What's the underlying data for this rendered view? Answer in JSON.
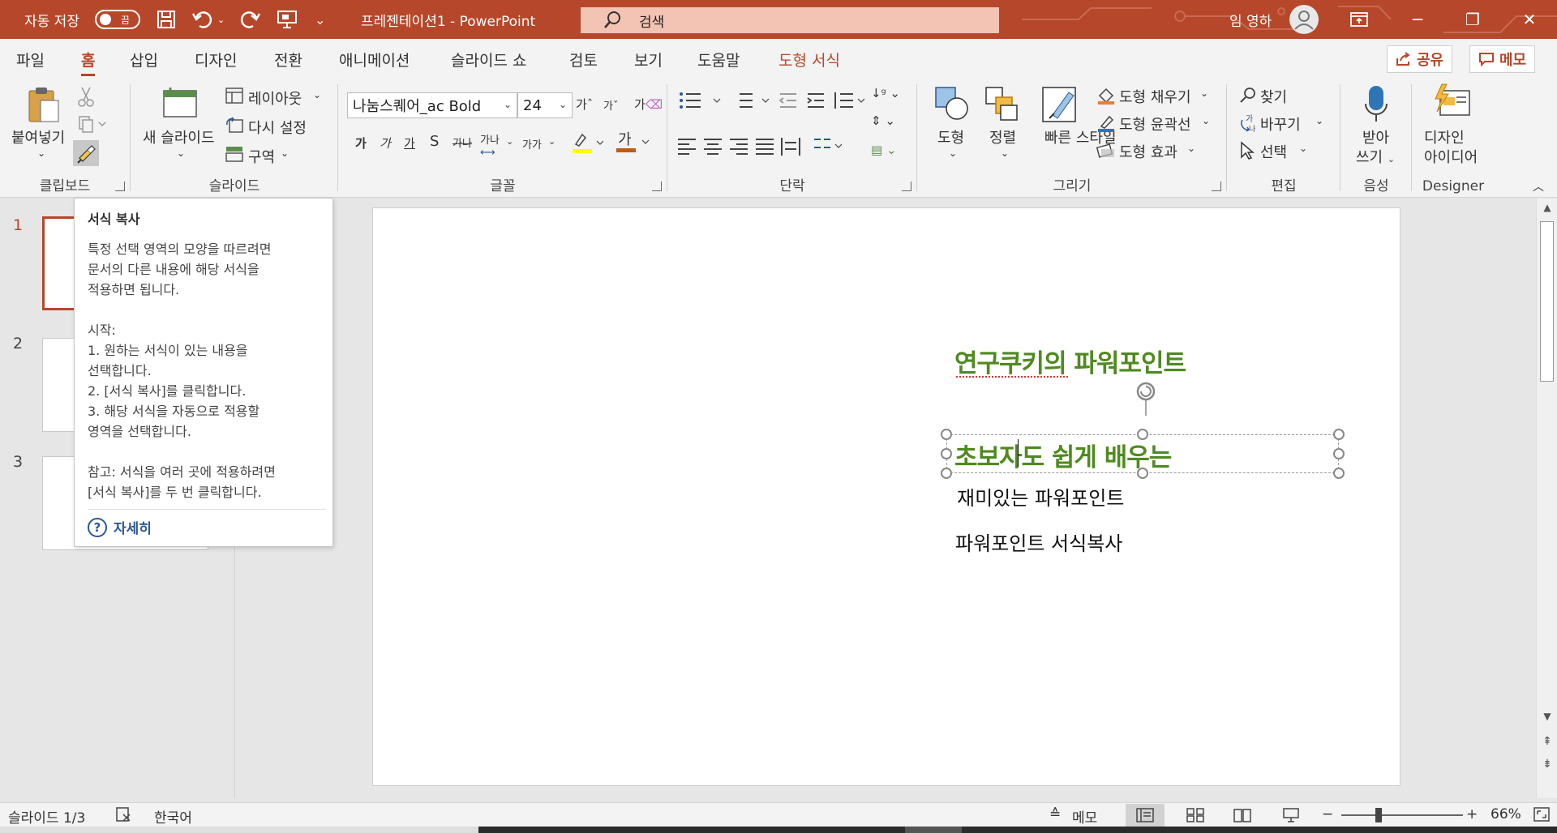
{
  "titlebar": {
    "autosave_label": "자동 저장",
    "autosave_state": "끔",
    "doc_title": "프레젠테이션1 - PowerPoint",
    "search_placeholder": "검색",
    "user_name": "임 영하",
    "accent_color": "#b7472a"
  },
  "tabs": [
    "파일",
    "홈",
    "삽입",
    "디자인",
    "전환",
    "애니메이션",
    "슬라이드 쇼",
    "검토",
    "보기",
    "도움말",
    "도형 서식"
  ],
  "active_tab": "홈",
  "top_buttons": {
    "share": "공유",
    "comments": "메모"
  },
  "ribbon": {
    "clipboard": {
      "paste": "붙여넣기",
      "label": "클립보드"
    },
    "slides": {
      "new_slide": "새 슬라이드",
      "layout": "레이아웃",
      "reset": "다시 설정",
      "section": "구역",
      "label": "슬라이드"
    },
    "font": {
      "font_name": "나눔스퀘어_ac Bold",
      "font_size": "24",
      "bold": "가",
      "italic": "가",
      "underline": "가",
      "shadow": "S",
      "strike": "가나",
      "case": "가가",
      "label": "글꼴"
    },
    "paragraph": {
      "label": "단락"
    },
    "drawing": {
      "shape": "도형",
      "arrange": "정렬",
      "quick_styles": "빠른 스타일",
      "fill": "도형 채우기",
      "outline": "도형 윤곽선",
      "effects": "도형 효과",
      "label": "그리기"
    },
    "editing": {
      "find": "찾기",
      "replace": "바꾸기",
      "select": "선택",
      "label": "편집"
    },
    "voice": {
      "dictate": "받아 쓰기",
      "label": "음성"
    },
    "designer": {
      "ideas": "디자인 아이디어",
      "label": "Designer"
    }
  },
  "slide_numbers": [
    "1",
    "2",
    "3"
  ],
  "tooltip": {
    "title": "서식 복사",
    "body": "특정 선택 영역의 모양을 따르려면\n문서의 다른 내용에 해당 서식을\n적용하면 됩니다.\n\n시작:\n1. 원하는 서식이 있는 내용을\n선택합니다.\n2. [서식 복사]를 클릭합니다.\n3. 해당 서식을 자동으로 적용할\n영역을 선택합니다.\n\n참고: 서식을 여러 곳에 적용하려면\n[서식 복사]를 두 번 클릭합니다.",
    "more": "자세히"
  },
  "slide": {
    "title_line": "연구쿠키의 파워포인트",
    "selected_line": "초보자도 쉽게 배우는",
    "line3": "재미있는 파워포인트",
    "line4": "파워포인트 서식복사",
    "text_green": "#4f8a1f"
  },
  "statusbar": {
    "slide_info": "슬라이드 1/3",
    "language": "한국어",
    "notes": "메모",
    "zoom": "66%"
  }
}
